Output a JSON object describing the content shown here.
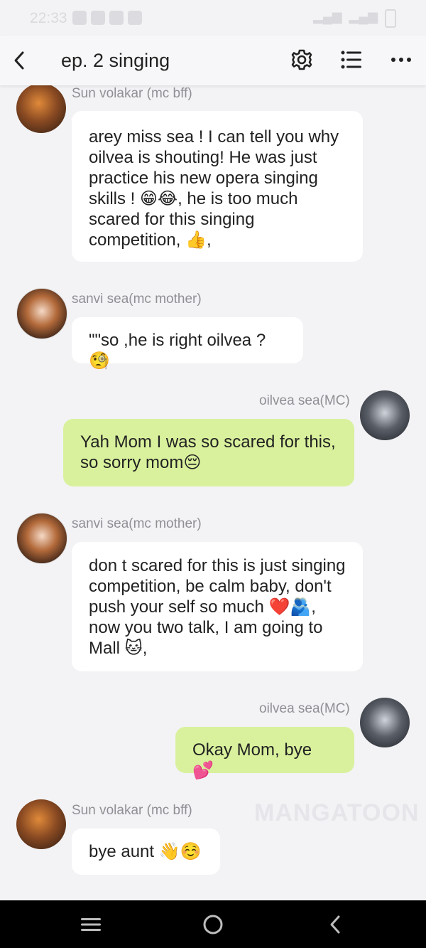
{
  "status_bar": {
    "time": "22:33"
  },
  "header": {
    "title": "ep. 2 singing"
  },
  "messages": [
    {
      "sender": "Sun volakar (mc bff)",
      "text": "arey miss sea ! I can tell you why oilvea is shouting! He was just practice his new opera singing skills ! 😁😂, he is too much scared for this singing competition, 👍,"
    },
    {
      "sender": "sanvi sea(mc mother)",
      "text": "\"\"so ,he is right oilvea ?🧐"
    },
    {
      "sender": "oilvea sea(MC)",
      "text": "Yah Mom I was so scared for this, so sorry  mom😔"
    },
    {
      "sender": "sanvi sea(mc mother)",
      "text": "don t scared for this is just singing competition, be calm baby, don't push your self so much ❤️🫂, now you two talk, I am going to Mall 🐱,"
    },
    {
      "sender": "oilvea sea(MC)",
      "text": "Okay Mom, bye 💕"
    },
    {
      "sender": "Sun volakar (mc bff)",
      "text": "bye aunt 👋☺️"
    }
  ],
  "watermark": "MANGATOON"
}
